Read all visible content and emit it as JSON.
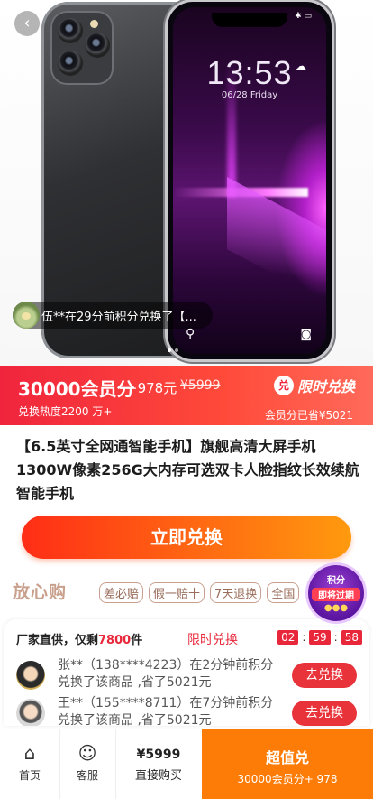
{
  "hero": {
    "phone": {
      "status_time": "",
      "clock": "13:53",
      "date": "06/28 Friday"
    },
    "ticker_text": "伍**在29分前积分兑换了【..."
  },
  "price": {
    "main": "30000会员分",
    "plus": "+978元",
    "original": "¥5999",
    "heat": "兑换热度2200 万+",
    "limit_label": "限时兑换",
    "limit_badge": "兑",
    "saved": "会员分已省¥5021"
  },
  "title": "【6.5英寸全网通智能手机】旗舰高清大屏手机1300W像素256G大内存可选双卡人脸指纹长效续航智能手机",
  "redeem_button": "立即兑换",
  "guarantee": {
    "title": "放心购",
    "tags": [
      "差必赔",
      "假一赔十",
      "7天退换",
      "全国"
    ]
  },
  "expire_badge": {
    "line1": "积分",
    "line2": "即将过期"
  },
  "activity": {
    "head_prefix": "厂家直供，仅剩",
    "head_count": "7800",
    "head_suffix": "件",
    "flash_label": "限时兑换",
    "countdown": [
      "02",
      "59",
      "58"
    ],
    "records": [
      {
        "text": "张**（138****4223）在2分钟前积分兑换了该商品 ,省了5021元",
        "button": "去兑换"
      },
      {
        "text": "王**（155****8711）在7分钟前积分兑换了该商品 ,省了5021元",
        "button": "去兑换"
      }
    ]
  },
  "bottom_bar": {
    "home": "首页",
    "service": "客服",
    "direct_price": "¥5999",
    "direct_label": "直接购买",
    "super_title": "超值兑",
    "super_sub": "30000会员分+ 978"
  },
  "colors": {
    "accent_red": "#e8273a",
    "orange": "#fd7c07",
    "guarantee_brown": "#c9a08c"
  }
}
